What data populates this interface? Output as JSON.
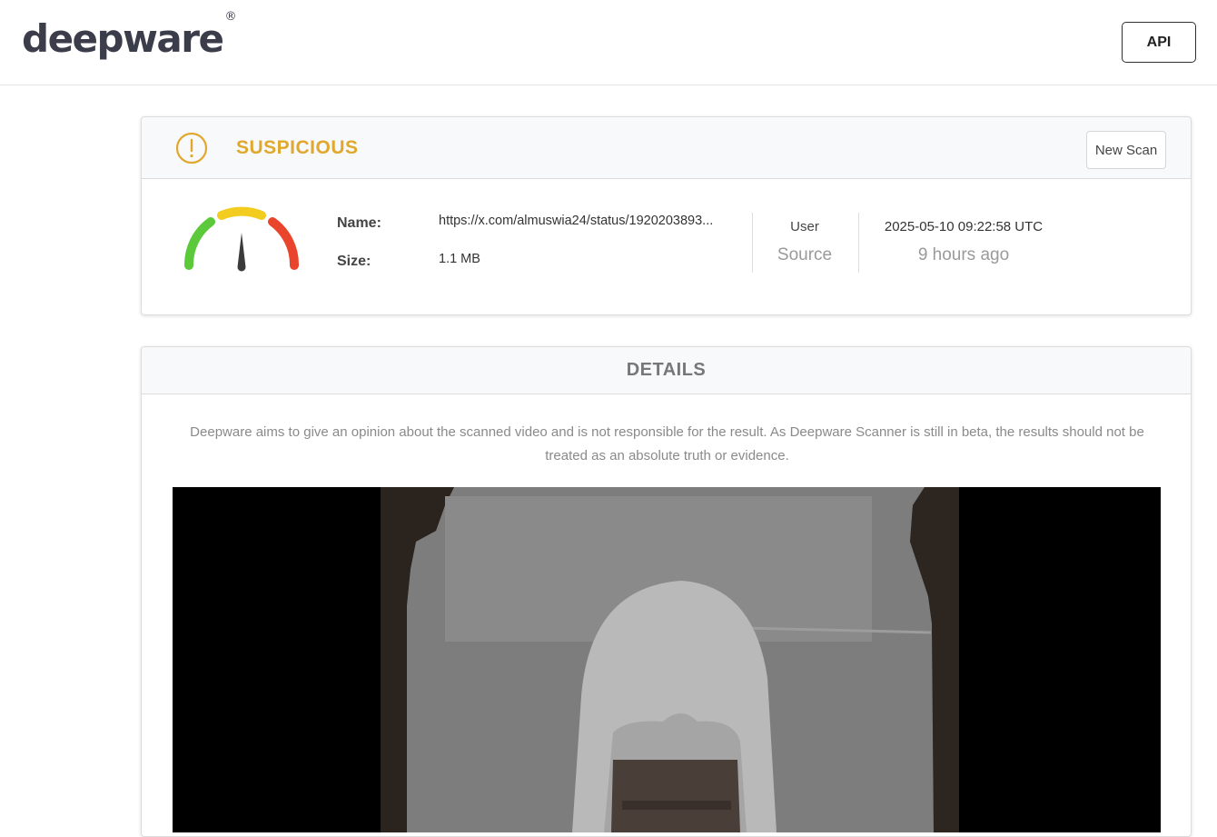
{
  "header": {
    "logo_text": "deepware",
    "logo_mark": "®",
    "api_label": "API"
  },
  "result": {
    "status": "SUSPICIOUS",
    "status_color": "#e0a82e",
    "status_icon": "warning-circle-icon",
    "new_scan_label": "New Scan",
    "gauge_level": "medium",
    "name_label": "Name:",
    "name_value": "https://x.com/almuswia24/status/1920203893...",
    "size_label": "Size:",
    "size_value": "1.1 MB",
    "source_value": "User",
    "source_label": "Source",
    "date_value": "2025-05-10 09:22:58 UTC",
    "date_relative": "9 hours ago"
  },
  "details": {
    "title": "DETAILS",
    "disclaimer": "Deepware aims to give an opinion about the scanned video and is not responsible for the result. As Deepware Scanner is still in beta, the results should not be treated as an absolute truth or evidence."
  },
  "colors": {
    "gauge_green": "#5cc93b",
    "gauge_yellow": "#f2cc1f",
    "gauge_red": "#e9452c"
  }
}
